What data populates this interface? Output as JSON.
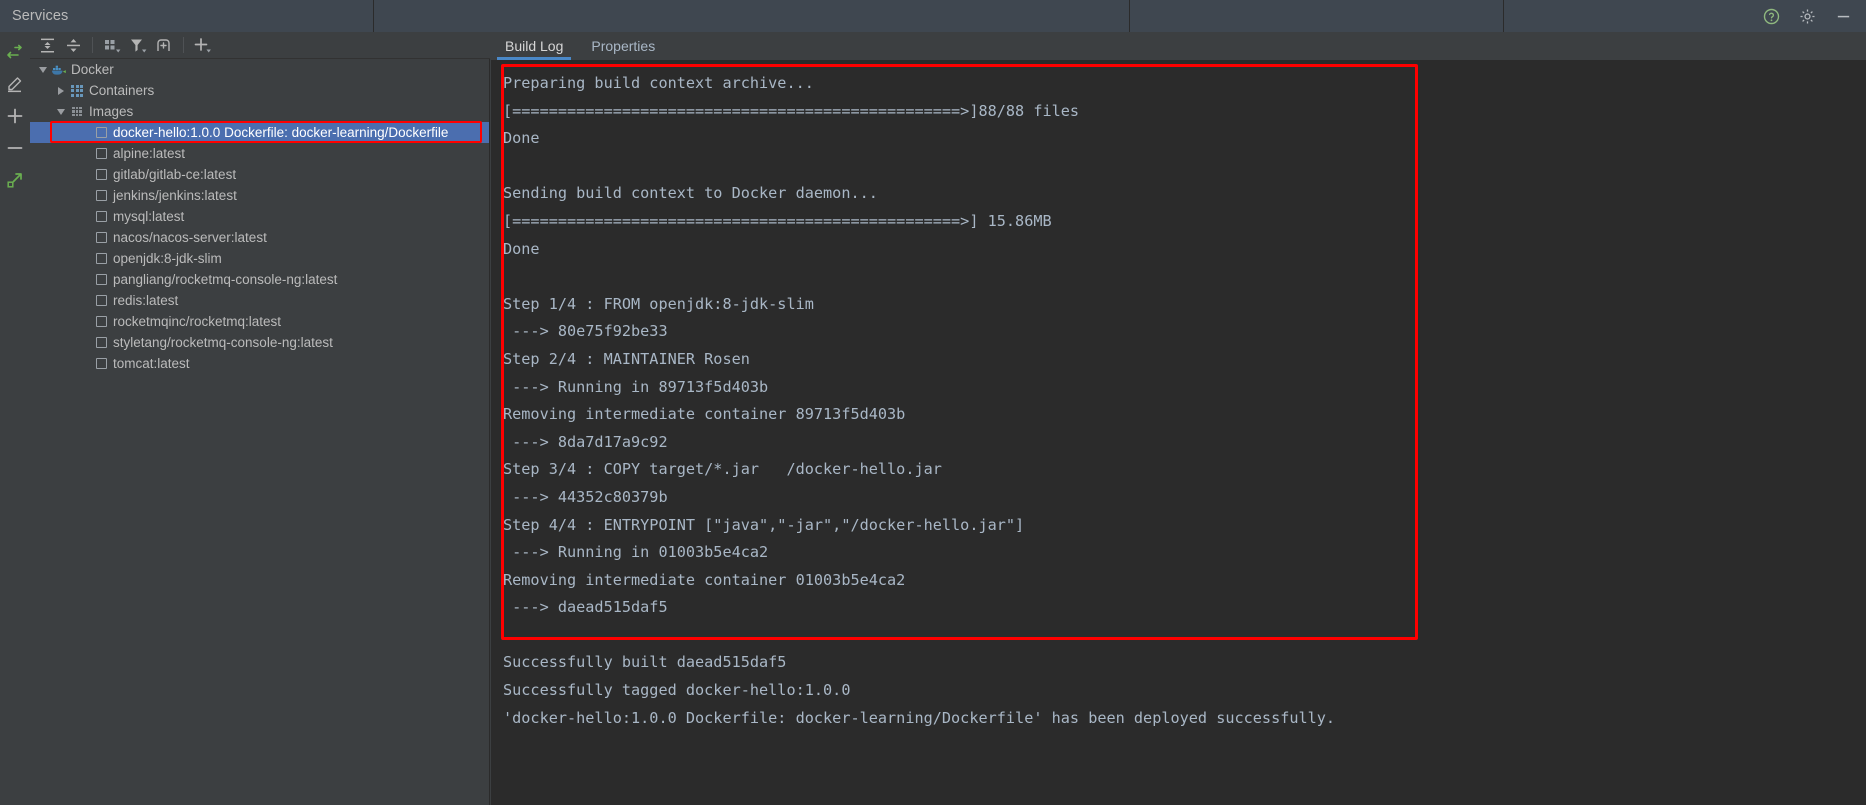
{
  "window": {
    "title": "Services",
    "title_cells": [
      "Services",
      "",
      "",
      ""
    ],
    "right_icons": [
      {
        "name": "help-icon",
        "glyph": "?"
      },
      {
        "name": "settings-gear-icon",
        "glyph": "gear"
      },
      {
        "name": "minimize-icon",
        "glyph": "minus"
      }
    ]
  },
  "left_rail": {
    "items": [
      {
        "name": "run-service-icon",
        "label": "Run",
        "color": "#6aaf50"
      },
      {
        "name": "edit-configuration-icon",
        "label": "Edit Configuration",
        "color": "#b4b4b4"
      },
      {
        "name": "add-icon",
        "label": "Add",
        "color": "#b4b4b4"
      },
      {
        "name": "remove-icon",
        "label": "Remove",
        "color": "#b4b4b4"
      },
      {
        "name": "expand-external-icon",
        "label": "Open in new window",
        "color": "#6aaf50"
      }
    ]
  },
  "tree_toolbar": {
    "buttons": [
      {
        "name": "expand-all-button",
        "label": "Expand All"
      },
      {
        "name": "collapse-all-button",
        "label": "Collapse All"
      },
      {
        "name": "group-by-button",
        "label": "Group By"
      },
      {
        "name": "filter-button",
        "label": "Filter"
      },
      {
        "name": "add-tab-button",
        "label": "Add Tab"
      },
      {
        "name": "add-service-button",
        "label": "Add Service"
      }
    ]
  },
  "tree": {
    "root": {
      "label": "Docker",
      "icon": "docker-whale-icon",
      "expanded": true
    },
    "containers": {
      "label": "Containers",
      "icon": "containers-grid-icon",
      "expanded": false
    },
    "images": {
      "label": "Images",
      "icon": "images-grid-icon",
      "expanded": true
    },
    "image_items": [
      {
        "label": "docker-hello:1.0.0 Dockerfile: docker-learning/Dockerfile",
        "selected": true
      },
      {
        "label": "alpine:latest",
        "selected": false
      },
      {
        "label": "gitlab/gitlab-ce:latest",
        "selected": false
      },
      {
        "label": "jenkins/jenkins:latest",
        "selected": false
      },
      {
        "label": "mysql:latest",
        "selected": false
      },
      {
        "label": "nacos/nacos-server:latest",
        "selected": false
      },
      {
        "label": "openjdk:8-jdk-slim",
        "selected": false
      },
      {
        "label": "pangliang/rocketmq-console-ng:latest",
        "selected": false
      },
      {
        "label": "redis:latest",
        "selected": false
      },
      {
        "label": "rocketmqinc/rocketmq:latest",
        "selected": false
      },
      {
        "label": "styletang/rocketmq-console-ng:latest",
        "selected": false
      },
      {
        "label": "tomcat:latest",
        "selected": false
      }
    ]
  },
  "tabs": [
    {
      "label": "Build Log",
      "active": true
    },
    {
      "label": "Properties",
      "active": false
    }
  ],
  "build_log": {
    "lines": [
      "Preparing build context archive...",
      "[=================================================>]88/88 files",
      "Done",
      "",
      "Sending build context to Docker daemon...",
      "[=================================================>] 15.86MB",
      "Done",
      "",
      "Step 1/4 : FROM openjdk:8-jdk-slim",
      " ---> 80e75f92be33",
      "Step 2/4 : MAINTAINER Rosen",
      " ---> Running in 89713f5d403b",
      "Removing intermediate container 89713f5d403b",
      " ---> 8da7d17a9c92",
      "Step 3/4 : COPY target/*.jar   /docker-hello.jar",
      " ---> 44352c80379b",
      "Step 4/4 : ENTRYPOINT [\"java\",\"-jar\",\"/docker-hello.jar\"]",
      " ---> Running in 01003b5e4ca2",
      "Removing intermediate container 01003b5e4ca2",
      " ---> daead515daf5",
      "",
      "Successfully built daead515daf5",
      "Successfully tagged docker-hello:1.0.0",
      "'docker-hello:1.0.0 Dockerfile: docker-learning/Dockerfile' has been deployed successfully."
    ]
  },
  "annotations": [
    {
      "name": "tree-selection-highlight",
      "color": "#ff0000"
    },
    {
      "name": "build-log-highlight",
      "color": "#ff0000"
    }
  ],
  "colors": {
    "panel_bg": "#3c3f41",
    "console_bg": "#2b2b2b",
    "selection_blue": "#4b6eaf",
    "tab_underline": "#4a88c7",
    "text": "#bbbbbb",
    "log_text": "#a9b7c6",
    "annotation_red": "#ff0000"
  }
}
